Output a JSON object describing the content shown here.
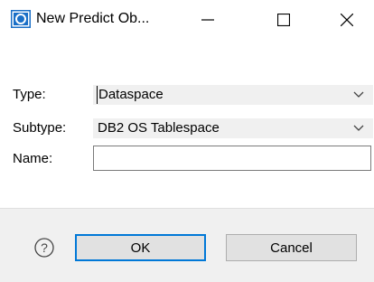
{
  "window": {
    "title": "New Predict Ob...",
    "icon": "app-icon",
    "controls": [
      "minimize-icon",
      "maximize-icon",
      "close-icon"
    ]
  },
  "form": {
    "type_label": "Type:",
    "type_value": "Dataspace",
    "subtype_label": "Subtype:",
    "subtype_value": "DB2 OS Tablespace",
    "name_label": "Name:",
    "name_value": "",
    "name_placeholder": ""
  },
  "footer": {
    "help_icon": "question-circle-icon",
    "ok_label": "OK",
    "cancel_label": "Cancel"
  },
  "colors": {
    "accent": "#0078d7",
    "app_icon": "#1a6fc7",
    "footer_bg": "#f0f0f0",
    "select_bg": "#f0f0f0"
  }
}
